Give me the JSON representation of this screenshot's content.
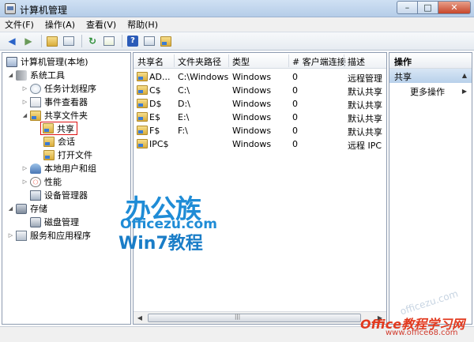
{
  "window": {
    "title": "计算机管理",
    "controls": {
      "minimize": "–",
      "maximize": "□",
      "close": "✕"
    }
  },
  "menu": [
    "文件(F)",
    "操作(A)",
    "查看(V)",
    "帮助(H)"
  ],
  "toolbar": {
    "icons": [
      "back-arrow-icon",
      "forward-arrow-icon",
      "folder-up-icon",
      "show-hide-tree-icon",
      "refresh-icon",
      "export-list-icon",
      "help-icon",
      "view-icon",
      "properties-icon"
    ],
    "help_glyph": "?"
  },
  "tree": {
    "root": "计算机管理(本地)",
    "system_tools": "系统工具",
    "task_scheduler": "任务计划程序",
    "event_viewer": "事件查看器",
    "shared_folders": "共享文件夹",
    "shares": "共享",
    "sessions": "会话",
    "open_files": "打开文件",
    "local_users": "本地用户和组",
    "performance": "性能",
    "device_manager": "设备管理器",
    "storage": "存储",
    "disk_management": "磁盘管理",
    "services_apps": "服务和应用程序"
  },
  "table": {
    "headers": [
      "共享名",
      "文件夹路径",
      "类型",
      "# 客户端连接",
      "描述"
    ],
    "rows": [
      {
        "name": "AD...",
        "path": "C:\\Windows",
        "type": "Windows",
        "clients": "0",
        "desc": "远程管理"
      },
      {
        "name": "C$",
        "path": "C:\\",
        "type": "Windows",
        "clients": "0",
        "desc": "默认共享"
      },
      {
        "name": "D$",
        "path": "D:\\",
        "type": "Windows",
        "clients": "0",
        "desc": "默认共享"
      },
      {
        "name": "E$",
        "path": "E:\\",
        "type": "Windows",
        "clients": "0",
        "desc": "默认共享"
      },
      {
        "name": "F$",
        "path": "F:\\",
        "type": "Windows",
        "clients": "0",
        "desc": "默认共享"
      },
      {
        "name": "IPC$",
        "path": "",
        "type": "Windows",
        "clients": "0",
        "desc": "远程 IPC"
      }
    ]
  },
  "actions": {
    "header": "操作",
    "section": "共享",
    "more": "更多操作"
  },
  "watermark": {
    "cn": "办公族",
    "en": "Officezu.com",
    "win7": "Win7教程",
    "office68": "Office教程学习网",
    "url": "www.office68.com",
    "faint": "officezu.com"
  }
}
